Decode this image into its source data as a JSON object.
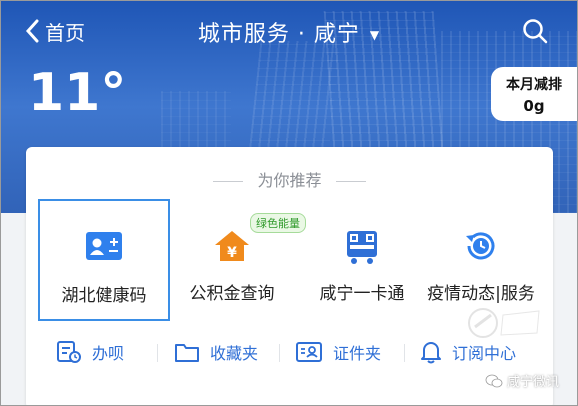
{
  "header": {
    "back_label": "首页",
    "title": "城市服务 · 咸宁",
    "title_caret": "▼"
  },
  "weather": {
    "temperature": "11°",
    "carbon_label": "本月减排",
    "carbon_value": "0g"
  },
  "recommend": {
    "heading": "为你推荐",
    "tiles": [
      {
        "label": "湖北健康码",
        "icon": "health-code-icon",
        "color": "#2f80ed"
      },
      {
        "label": "公积金查询",
        "icon": "housing-fund-icon",
        "color": "#f08a1c",
        "badge": "绿色能量"
      },
      {
        "label": "咸宁一卡通",
        "icon": "bus-card-icon",
        "color": "#2f6fd6"
      },
      {
        "label": "疫情动态|服务",
        "icon": "refresh-clock-icon",
        "color": "#2f80ed"
      }
    ]
  },
  "bottom_bar": {
    "items": [
      {
        "label": "办呗",
        "icon": "document-clock-icon"
      },
      {
        "label": "收藏夹",
        "icon": "folder-icon"
      },
      {
        "label": "证件夹",
        "icon": "id-card-icon"
      },
      {
        "label": "订阅中心",
        "icon": "bell-icon"
      }
    ]
  },
  "watermark": {
    "text": "咸宁微讯"
  },
  "colors": {
    "banner": "#2f66c3",
    "accent": "#2f6fd6",
    "selected_border": "#3a8ee6"
  }
}
